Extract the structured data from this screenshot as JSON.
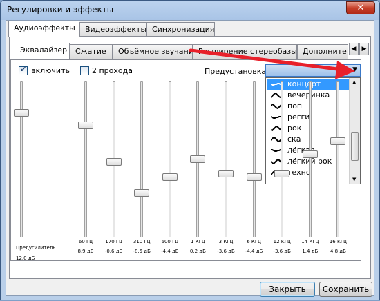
{
  "window": {
    "title": "Регулировки и эффекты"
  },
  "tabs": [
    "Аудиоэффекты",
    "Видеоэффекты",
    "Синхронизация"
  ],
  "subtabs": [
    "Эквалайзер",
    "Сжатие",
    "Объёмное звучание",
    "Расширение стереобазы",
    "Дополните"
  ],
  "scroll_arrows": {
    "left": "◀",
    "right": "▶"
  },
  "equalizer": {
    "enable_label": "включить",
    "enable_checked": true,
    "two_pass_label": "2 прохода",
    "two_pass_checked": false,
    "preset_label": "Предустановка",
    "preamp": {
      "label": "Предусилитель",
      "value_label": "12.0 дБ",
      "value_db": 12.0
    },
    "bands": [
      {
        "freq": "60 Гц",
        "gain": "8.9 дБ",
        "db": 8.9
      },
      {
        "freq": "170 Гц",
        "gain": "-0.6 дБ",
        "db": -0.6
      },
      {
        "freq": "310 Гц",
        "gain": "-8.5 дБ",
        "db": -8.5
      },
      {
        "freq": "600 Гц",
        "gain": "-4.4 дБ",
        "db": -4.4
      },
      {
        "freq": "1 КГц",
        "gain": "0.2 дБ",
        "db": 0.2
      },
      {
        "freq": "3 КГц",
        "gain": "-3.6 дБ",
        "db": -3.6
      },
      {
        "freq": "6 КГц",
        "gain": "-4.4 дБ",
        "db": -4.4
      },
      {
        "freq": "12 КГц",
        "gain": "-3.6 дБ",
        "db": -3.6
      },
      {
        "freq": "14 КГц",
        "gain": "1.4 дБ",
        "db": 1.4
      },
      {
        "freq": "16 КГц",
        "gain": "4.8 дБ",
        "db": 4.8
      }
    ]
  },
  "preset_dropdown": {
    "items": [
      "концерт",
      "вечеринка",
      "поп",
      "регги",
      "рок",
      "ска",
      "лёгкая",
      "лёгкий рок",
      "техно"
    ],
    "selected_index": 0
  },
  "buttons": {
    "close": "Закрыть",
    "save": "Сохранить"
  },
  "colors": {
    "selection": "#3399ff",
    "annotation_arrow": "#e8202a"
  }
}
